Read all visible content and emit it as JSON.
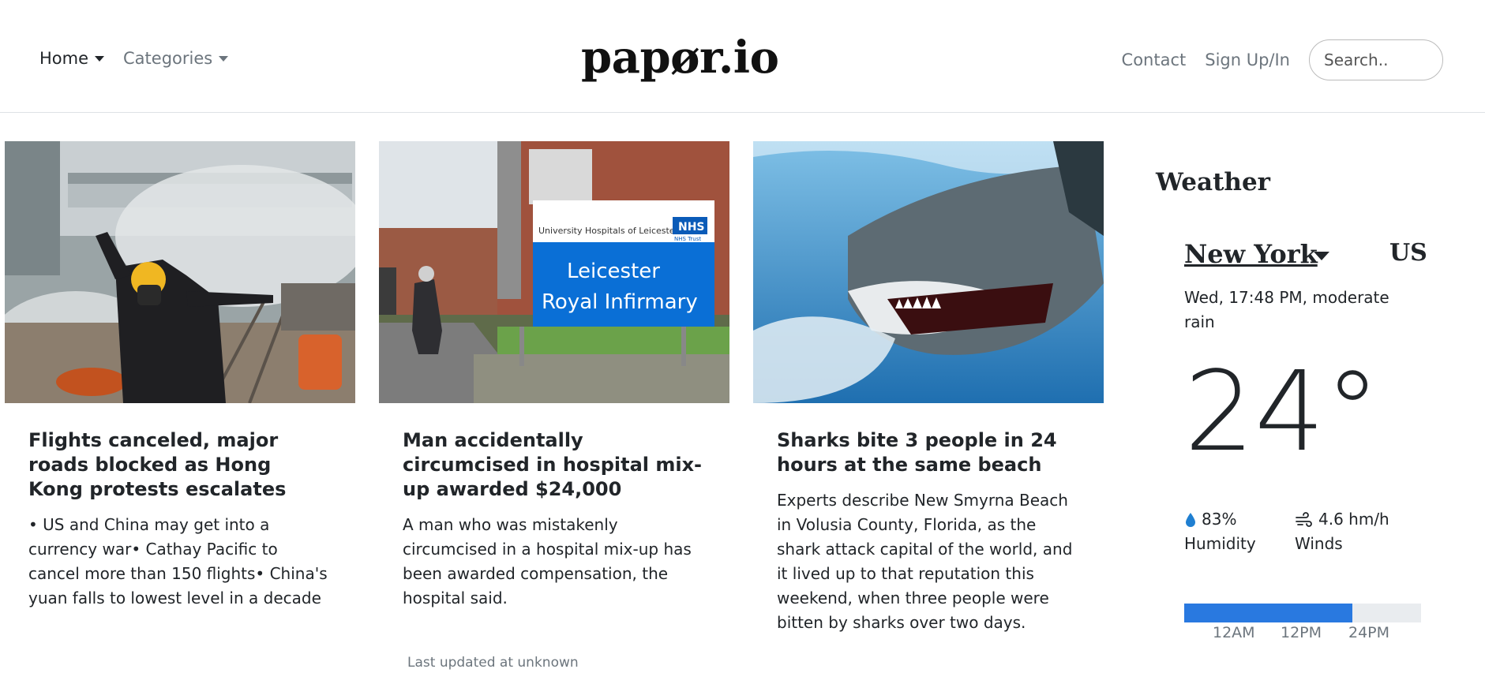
{
  "nav": {
    "home_label": "Home",
    "categories_label": "Categories",
    "brand": "papør.io",
    "contact_label": "Contact",
    "signup_label": "Sign Up/In",
    "search_placeholder": "Search.."
  },
  "articles": [
    {
      "title": "Flights canceled, major roads blocked as Hong Kong protests escalates",
      "text": "• US and China may get into a currency war• Cathay Pacific to cancel more than 150 flights• China's yuan falls to lowest level in a decade",
      "image": "protester-photo"
    },
    {
      "title": "Man accidentally circumcised in hospital mix-up awarded $24,000",
      "text": "A man who was mistakenly circumcised in a hospital mix-up has been awarded compensation, the hospital said.",
      "image": "hospital-photo",
      "sign_line1": "University Hospitals of Leicester",
      "sign_badge": "NHS",
      "sign_sub": "NHS Trust",
      "sign_main1": "Leicester",
      "sign_main2": "Royal Infirmary"
    },
    {
      "title": "Sharks bite 3 people in 24 hours at the same beach",
      "text": "Experts describe New Smyrna Beach in Volusia County, Florida, as the shark attack capital of the world, and it lived up to that reputation this weekend, when three people were bitten by sharks over two days.",
      "image": "shark-photo"
    }
  ],
  "footer_text": "Last updated at unknown",
  "weather": {
    "title": "Weather",
    "city": "New York",
    "country": "US",
    "description": "Wed, 17:48 PM, moderate rain",
    "temperature": "24°",
    "humidity_value": "83%",
    "humidity_label": "Humidity",
    "wind_value": "4.6 hm/h",
    "wind_label": "Winds",
    "day_progress": 0.71,
    "ticks": [
      "12AM",
      "12PM",
      "24PM"
    ],
    "accent_color": "#2979e0"
  }
}
